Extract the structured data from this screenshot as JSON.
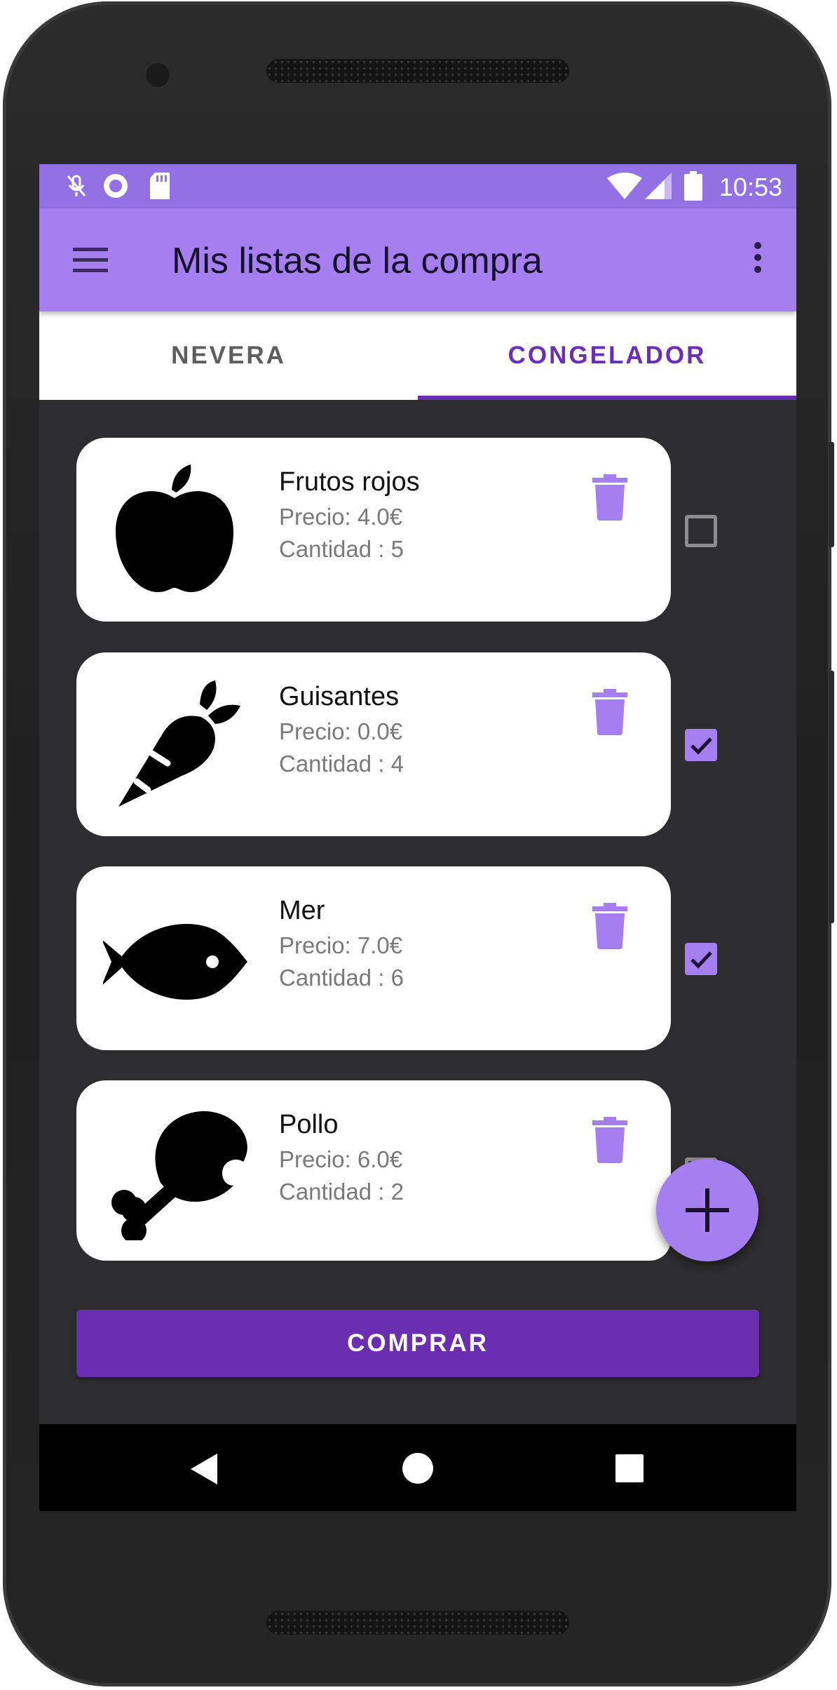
{
  "status_bar": {
    "time": "10:53",
    "icons": [
      "mic-off-icon",
      "sync-icon",
      "sd-card-icon",
      "wifi-icon",
      "signal-icon",
      "battery-icon"
    ]
  },
  "app_bar": {
    "title": "Mis listas de la compra",
    "menu_icon": "hamburger-menu-icon",
    "overflow_icon": "more-vertical-icon"
  },
  "tabs": [
    {
      "label": "NEVERA",
      "selected": false
    },
    {
      "label": "CONGELADOR",
      "selected": true
    }
  ],
  "items": [
    {
      "name": "Frutos rojos",
      "price": "Precio: 4.0€",
      "quantity": "Cantidad : 5",
      "icon": "apple-icon",
      "checked": false
    },
    {
      "name": "Guisantes",
      "price": "Precio: 0.0€",
      "quantity": "Cantidad : 4",
      "icon": "carrot-icon",
      "checked": true
    },
    {
      "name": "Mer",
      "price": "Precio: 7.0€",
      "quantity": "Cantidad : 6",
      "icon": "fish-icon",
      "checked": true
    },
    {
      "name": "Pollo",
      "price": "Precio: 6.0€",
      "quantity": "Cantidad : 2",
      "icon": "chicken-leg-icon",
      "checked": false
    }
  ],
  "fab": {
    "icon": "plus-icon"
  },
  "buy_button": {
    "label": "COMPRAR"
  },
  "colors": {
    "status_bar": "#9370e3",
    "app_bar": "#a57ef0",
    "accent": "#6a2eb8",
    "background": "#2d2d2f",
    "icon_purple": "#a57ef0"
  }
}
